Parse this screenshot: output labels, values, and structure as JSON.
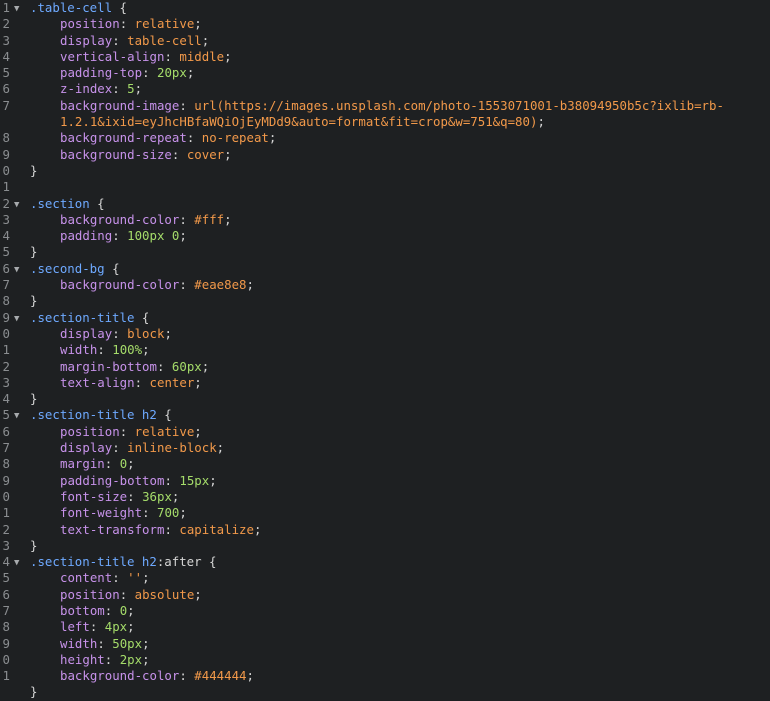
{
  "editor": {
    "language": "css",
    "colors": {
      "background": "#1e2022",
      "selector": "#6ea9ff",
      "property": "#c792ea",
      "value": "#f2994a",
      "number": "#a5dc6a",
      "punctuation": "#d6d6d6",
      "line_number": "#8a8d90"
    },
    "fold_icon": "triangle-down-icon",
    "lines": [
      {
        "n": "1",
        "fold": true,
        "tokens": [
          {
            "t": "sel",
            "v": ".table-cell"
          },
          {
            "t": "punc",
            "v": " {"
          }
        ]
      },
      {
        "n": "2",
        "indent": true,
        "tokens": [
          {
            "t": "prop",
            "v": "position"
          },
          {
            "t": "punc",
            "v": ": "
          },
          {
            "t": "val",
            "v": "relative"
          },
          {
            "t": "punc",
            "v": ";"
          }
        ]
      },
      {
        "n": "3",
        "indent": true,
        "tokens": [
          {
            "t": "prop",
            "v": "display"
          },
          {
            "t": "punc",
            "v": ": "
          },
          {
            "t": "val",
            "v": "table-cell"
          },
          {
            "t": "punc",
            "v": ";"
          }
        ]
      },
      {
        "n": "4",
        "indent": true,
        "tokens": [
          {
            "t": "prop",
            "v": "vertical-align"
          },
          {
            "t": "punc",
            "v": ": "
          },
          {
            "t": "val",
            "v": "middle"
          },
          {
            "t": "punc",
            "v": ";"
          }
        ]
      },
      {
        "n": "5",
        "indent": true,
        "tokens": [
          {
            "t": "prop",
            "v": "padding-top"
          },
          {
            "t": "punc",
            "v": ": "
          },
          {
            "t": "num",
            "v": "20px"
          },
          {
            "t": "punc",
            "v": ";"
          }
        ]
      },
      {
        "n": "6",
        "indent": true,
        "tokens": [
          {
            "t": "prop",
            "v": "z-index"
          },
          {
            "t": "punc",
            "v": ": "
          },
          {
            "t": "num",
            "v": "5"
          },
          {
            "t": "punc",
            "v": ";"
          }
        ]
      },
      {
        "n": "7",
        "indent": true,
        "tokens": [
          {
            "t": "prop",
            "v": "background-image"
          },
          {
            "t": "punc",
            "v": ": "
          },
          {
            "t": "val",
            "v": "url(https://images.unsplash.com/photo-1553071001-b38094950b5c?ixlib=rb-"
          }
        ]
      },
      {
        "n": "",
        "indent": true,
        "tokens": [
          {
            "t": "val",
            "v": "1.2.1&ixid=eyJhcHBfaWQiOjEyMDd9&auto=format&fit=crop&w=751&q=80)"
          },
          {
            "t": "punc",
            "v": ";"
          }
        ]
      },
      {
        "n": "8",
        "indent": true,
        "tokens": [
          {
            "t": "prop",
            "v": "background-repeat"
          },
          {
            "t": "punc",
            "v": ": "
          },
          {
            "t": "val",
            "v": "no-repeat"
          },
          {
            "t": "punc",
            "v": ";"
          }
        ]
      },
      {
        "n": "9",
        "indent": true,
        "tokens": [
          {
            "t": "prop",
            "v": "background-size"
          },
          {
            "t": "punc",
            "v": ": "
          },
          {
            "t": "val",
            "v": "cover"
          },
          {
            "t": "punc",
            "v": ";"
          }
        ]
      },
      {
        "n": "0",
        "tokens": [
          {
            "t": "punc",
            "v": "}"
          }
        ]
      },
      {
        "n": "1",
        "tokens": []
      },
      {
        "n": "2",
        "fold": true,
        "tokens": [
          {
            "t": "sel",
            "v": ".section"
          },
          {
            "t": "punc",
            "v": " {"
          }
        ]
      },
      {
        "n": "3",
        "indent": true,
        "tokens": [
          {
            "t": "prop",
            "v": "background-color"
          },
          {
            "t": "punc",
            "v": ": "
          },
          {
            "t": "val",
            "v": "#fff"
          },
          {
            "t": "punc",
            "v": ";"
          }
        ]
      },
      {
        "n": "4",
        "indent": true,
        "tokens": [
          {
            "t": "prop",
            "v": "padding"
          },
          {
            "t": "punc",
            "v": ": "
          },
          {
            "t": "num",
            "v": "100px 0"
          },
          {
            "t": "punc",
            "v": ";"
          }
        ]
      },
      {
        "n": "5",
        "tokens": [
          {
            "t": "punc",
            "v": "}"
          }
        ]
      },
      {
        "n": "6",
        "fold": true,
        "tokens": [
          {
            "t": "sel",
            "v": ".second-bg"
          },
          {
            "t": "punc",
            "v": " {"
          }
        ]
      },
      {
        "n": "7",
        "indent": true,
        "tokens": [
          {
            "t": "prop",
            "v": "background-color"
          },
          {
            "t": "punc",
            "v": ": "
          },
          {
            "t": "val",
            "v": "#eae8e8"
          },
          {
            "t": "punc",
            "v": ";"
          }
        ]
      },
      {
        "n": "8",
        "tokens": [
          {
            "t": "punc",
            "v": "}"
          }
        ]
      },
      {
        "n": "9",
        "fold": true,
        "tokens": [
          {
            "t": "sel",
            "v": ".section-title"
          },
          {
            "t": "punc",
            "v": " {"
          }
        ]
      },
      {
        "n": "0",
        "indent": true,
        "tokens": [
          {
            "t": "prop",
            "v": "display"
          },
          {
            "t": "punc",
            "v": ": "
          },
          {
            "t": "val",
            "v": "block"
          },
          {
            "t": "punc",
            "v": ";"
          }
        ]
      },
      {
        "n": "1",
        "indent": true,
        "tokens": [
          {
            "t": "prop",
            "v": "width"
          },
          {
            "t": "punc",
            "v": ": "
          },
          {
            "t": "num",
            "v": "100%"
          },
          {
            "t": "punc",
            "v": ";"
          }
        ]
      },
      {
        "n": "2",
        "indent": true,
        "tokens": [
          {
            "t": "prop",
            "v": "margin-bottom"
          },
          {
            "t": "punc",
            "v": ": "
          },
          {
            "t": "num",
            "v": "60px"
          },
          {
            "t": "punc",
            "v": ";"
          }
        ]
      },
      {
        "n": "3",
        "indent": true,
        "tokens": [
          {
            "t": "prop",
            "v": "text-align"
          },
          {
            "t": "punc",
            "v": ": "
          },
          {
            "t": "val",
            "v": "center"
          },
          {
            "t": "punc",
            "v": ";"
          }
        ]
      },
      {
        "n": "4",
        "tokens": [
          {
            "t": "punc",
            "v": "}"
          }
        ]
      },
      {
        "n": "5",
        "fold": true,
        "tokens": [
          {
            "t": "sel",
            "v": ".section-title h2"
          },
          {
            "t": "punc",
            "v": " {"
          }
        ]
      },
      {
        "n": "6",
        "indent": true,
        "tokens": [
          {
            "t": "prop",
            "v": "position"
          },
          {
            "t": "punc",
            "v": ": "
          },
          {
            "t": "val",
            "v": "relative"
          },
          {
            "t": "punc",
            "v": ";"
          }
        ]
      },
      {
        "n": "7",
        "indent": true,
        "tokens": [
          {
            "t": "prop",
            "v": "display"
          },
          {
            "t": "punc",
            "v": ": "
          },
          {
            "t": "val",
            "v": "inline-block"
          },
          {
            "t": "punc",
            "v": ";"
          }
        ]
      },
      {
        "n": "8",
        "indent": true,
        "tokens": [
          {
            "t": "prop",
            "v": "margin"
          },
          {
            "t": "punc",
            "v": ": "
          },
          {
            "t": "num",
            "v": "0"
          },
          {
            "t": "punc",
            "v": ";"
          }
        ]
      },
      {
        "n": "9",
        "indent": true,
        "tokens": [
          {
            "t": "prop",
            "v": "padding-bottom"
          },
          {
            "t": "punc",
            "v": ": "
          },
          {
            "t": "num",
            "v": "15px"
          },
          {
            "t": "punc",
            "v": ";"
          }
        ]
      },
      {
        "n": "0",
        "indent": true,
        "tokens": [
          {
            "t": "prop",
            "v": "font-size"
          },
          {
            "t": "punc",
            "v": ": "
          },
          {
            "t": "num",
            "v": "36px"
          },
          {
            "t": "punc",
            "v": ";"
          }
        ]
      },
      {
        "n": "1",
        "indent": true,
        "tokens": [
          {
            "t": "prop",
            "v": "font-weight"
          },
          {
            "t": "punc",
            "v": ": "
          },
          {
            "t": "num",
            "v": "700"
          },
          {
            "t": "punc",
            "v": ";"
          }
        ]
      },
      {
        "n": "2",
        "indent": true,
        "tokens": [
          {
            "t": "prop",
            "v": "text-transform"
          },
          {
            "t": "punc",
            "v": ": "
          },
          {
            "t": "val",
            "v": "capitalize"
          },
          {
            "t": "punc",
            "v": ";"
          }
        ]
      },
      {
        "n": "3",
        "tokens": [
          {
            "t": "punc",
            "v": "}"
          }
        ]
      },
      {
        "n": "4",
        "fold": true,
        "tokens": [
          {
            "t": "sel",
            "v": ".section-title h2"
          },
          {
            "t": "punc",
            "v": ":after {"
          }
        ]
      },
      {
        "n": "5",
        "indent": true,
        "tokens": [
          {
            "t": "prop",
            "v": "content"
          },
          {
            "t": "punc",
            "v": ": "
          },
          {
            "t": "val",
            "v": "''"
          },
          {
            "t": "punc",
            "v": ";"
          }
        ]
      },
      {
        "n": "6",
        "indent": true,
        "tokens": [
          {
            "t": "prop",
            "v": "position"
          },
          {
            "t": "punc",
            "v": ": "
          },
          {
            "t": "val",
            "v": "absolute"
          },
          {
            "t": "punc",
            "v": ";"
          }
        ]
      },
      {
        "n": "7",
        "indent": true,
        "tokens": [
          {
            "t": "prop",
            "v": "bottom"
          },
          {
            "t": "punc",
            "v": ": "
          },
          {
            "t": "num",
            "v": "0"
          },
          {
            "t": "punc",
            "v": ";"
          }
        ]
      },
      {
        "n": "8",
        "indent": true,
        "tokens": [
          {
            "t": "prop",
            "v": "left"
          },
          {
            "t": "punc",
            "v": ": "
          },
          {
            "t": "num",
            "v": "4px"
          },
          {
            "t": "punc",
            "v": ";"
          }
        ]
      },
      {
        "n": "9",
        "indent": true,
        "tokens": [
          {
            "t": "prop",
            "v": "width"
          },
          {
            "t": "punc",
            "v": ": "
          },
          {
            "t": "num",
            "v": "50px"
          },
          {
            "t": "punc",
            "v": ";"
          }
        ]
      },
      {
        "n": "0",
        "indent": true,
        "tokens": [
          {
            "t": "prop",
            "v": "height"
          },
          {
            "t": "punc",
            "v": ": "
          },
          {
            "t": "num",
            "v": "2px"
          },
          {
            "t": "punc",
            "v": ";"
          }
        ]
      },
      {
        "n": "1",
        "indent": true,
        "tokens": [
          {
            "t": "prop",
            "v": "background-color"
          },
          {
            "t": "punc",
            "v": ": "
          },
          {
            "t": "val",
            "v": "#444444"
          },
          {
            "t": "punc",
            "v": ";"
          }
        ]
      },
      {
        "n": "",
        "tokens": [
          {
            "t": "punc",
            "v": "}"
          }
        ]
      }
    ]
  }
}
